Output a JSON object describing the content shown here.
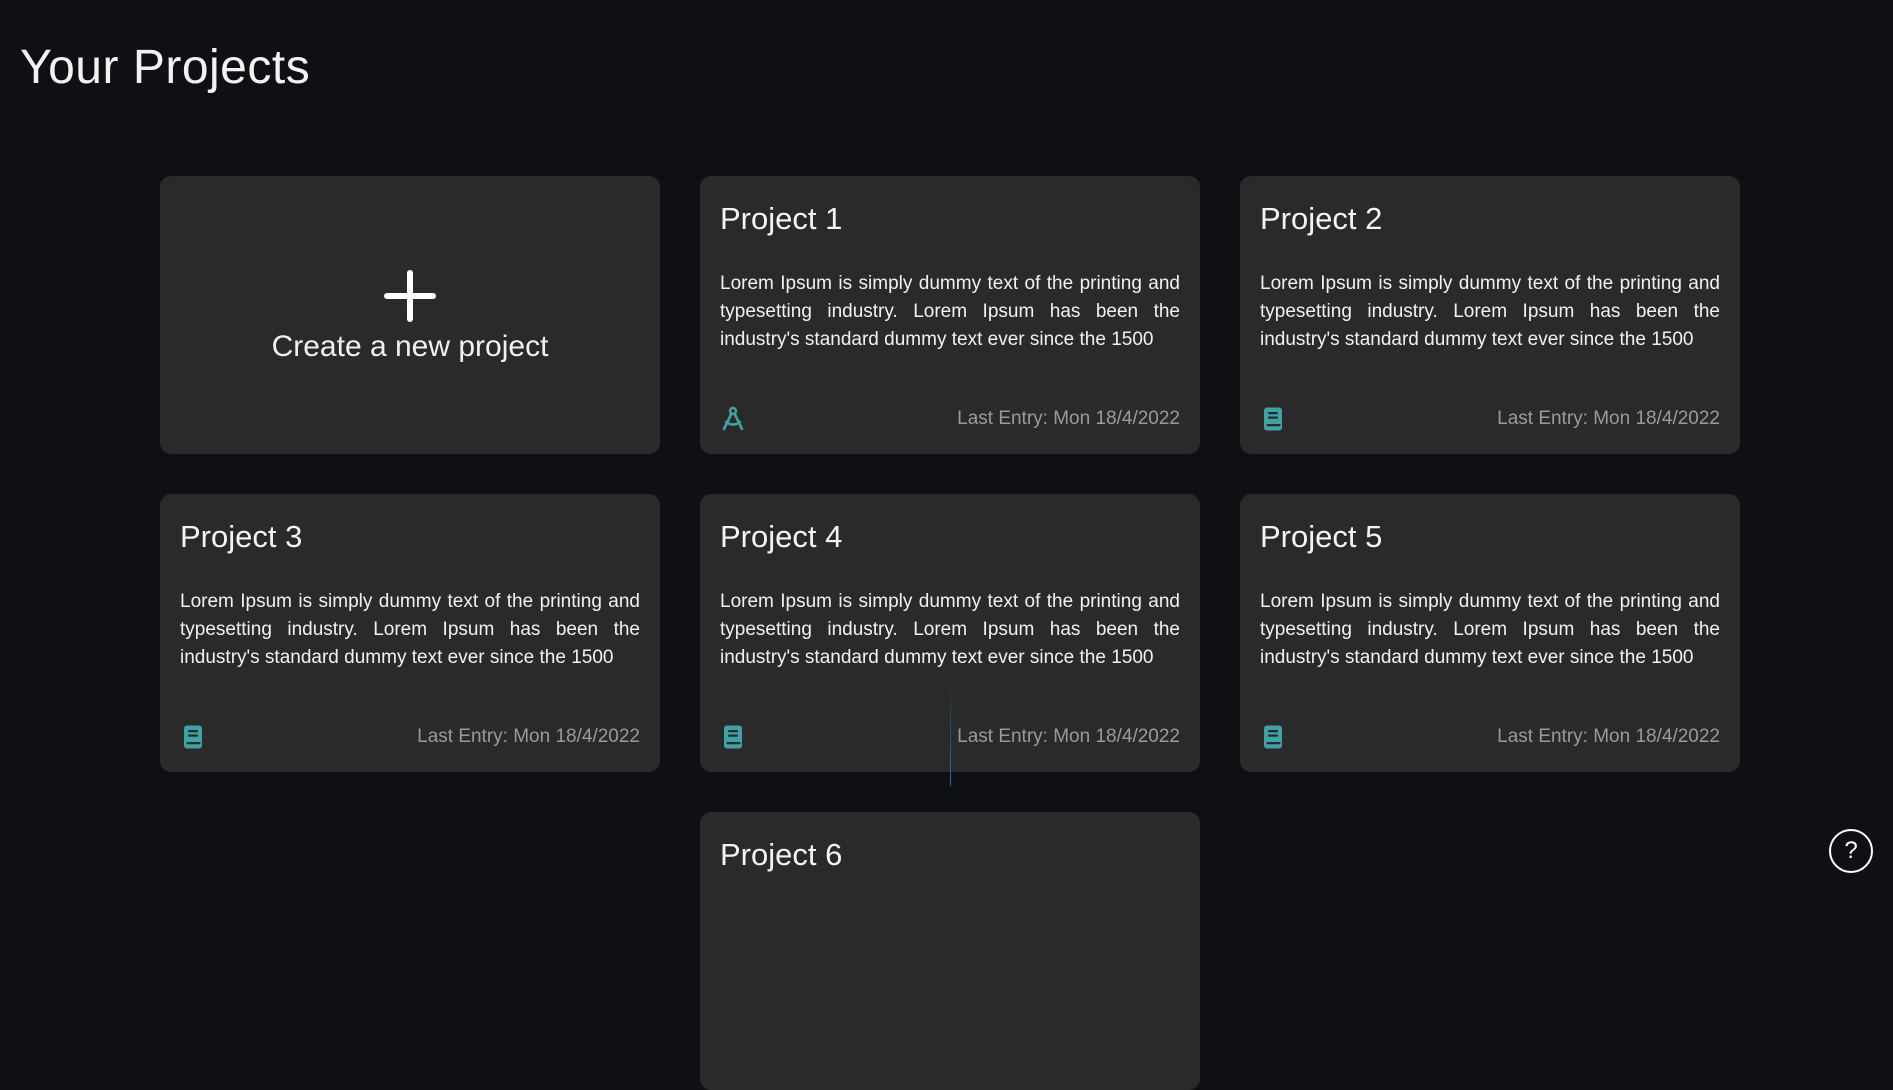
{
  "page": {
    "title": "Your Projects"
  },
  "new_project": {
    "label": "Create a new project"
  },
  "projects": [
    {
      "title": "Project 1",
      "description": "Lorem Ipsum is simply dummy text of the printing and typesetting industry. Lorem Ipsum has been the industry's standard dummy text ever since the 1500",
      "last_entry": "Last Entry: Mon 18/4/2022",
      "icon": "compass-icon"
    },
    {
      "title": "Project 2",
      "description": "Lorem Ipsum is simply dummy text of the printing and typesetting industry. Lorem Ipsum has been the industry's standard dummy text ever since the 1500",
      "last_entry": "Last Entry: Mon 18/4/2022",
      "icon": "book-icon"
    },
    {
      "title": "Project 3",
      "description": "Lorem Ipsum is simply dummy text of the printing and typesetting industry. Lorem Ipsum has been the industry's standard dummy text ever since the 1500",
      "last_entry": "Last Entry: Mon 18/4/2022",
      "icon": "book-icon"
    },
    {
      "title": "Project 4",
      "description": "Lorem Ipsum is simply dummy text of the printing and typesetting industry. Lorem Ipsum has been the industry's standard dummy text ever since the 1500",
      "last_entry": "Last Entry: Mon 18/4/2022",
      "icon": "book-icon"
    },
    {
      "title": "Project 5",
      "description": "Lorem Ipsum is simply dummy text of the printing and typesetting industry. Lorem Ipsum has been the industry's standard dummy text ever since the 1500",
      "last_entry": "Last Entry: Mon 18/4/2022",
      "icon": "book-icon"
    },
    {
      "title": "Project 6",
      "description": "",
      "last_entry": "",
      "icon": ""
    }
  ],
  "help": {
    "label": "?",
    "icon": "question-icon"
  },
  "colors": {
    "background": "#0f1014",
    "card": "#2a2a2a",
    "accent": "#3fa3a6",
    "muted_text": "#9a9a9a"
  }
}
